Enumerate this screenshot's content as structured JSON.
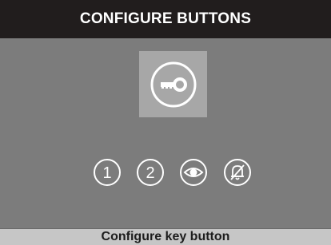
{
  "header": {
    "title": "CONFIGURE BUTTONS"
  },
  "selected_button": {
    "icon": "key-icon"
  },
  "buttons": [
    {
      "icon": "number-one-icon",
      "label": "1"
    },
    {
      "icon": "number-two-icon",
      "label": "2"
    },
    {
      "icon": "eye-icon"
    },
    {
      "icon": "bell-off-icon"
    }
  ],
  "status": {
    "text": "Configure key button"
  },
  "colors": {
    "title_background": "#211d1d",
    "screen_background": "#7c7c7c",
    "selected_tile": "#a7a7a7",
    "status_background": "#c6c6c6",
    "icon": "#ffffff"
  }
}
